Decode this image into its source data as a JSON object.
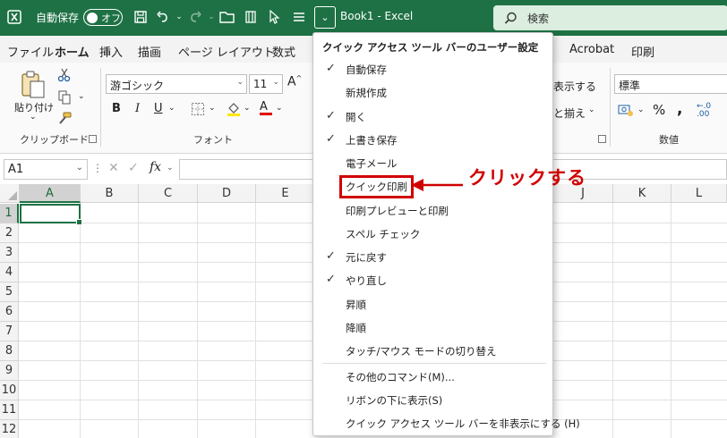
{
  "titlebar": {
    "autosave_label": "自動保存",
    "toggle_state": "オフ",
    "doc_title": "Book1  -  Excel",
    "search_placeholder": "検索"
  },
  "tabs": [
    "ファイル",
    "ホーム",
    "挿入",
    "描画",
    "ページ レイアウト",
    "数式",
    "Acrobat",
    "印刷"
  ],
  "ribbon": {
    "paste_label": "貼り付け",
    "clipboard_group": "クリップボード",
    "font_name": "游ゴシック",
    "font_size": "11",
    "font_group": "フォント",
    "wrap_text": "表示する",
    "merge": "と揃え",
    "number_format": "標準",
    "number_group": "数値",
    "percent": "%"
  },
  "formula_bar": {
    "name_box": "A1",
    "fx": "fx"
  },
  "grid": {
    "columns": [
      "A",
      "B",
      "C",
      "D",
      "E",
      "J",
      "K",
      "L"
    ],
    "rows": [
      "1",
      "2",
      "3",
      "4",
      "5",
      "6",
      "7",
      "8",
      "9",
      "10",
      "11",
      "12"
    ]
  },
  "menu": {
    "title": "クイック アクセス ツール バーのユーザー設定",
    "items": [
      {
        "label": "自動保存",
        "checked": true
      },
      {
        "label": "新規作成",
        "checked": false
      },
      {
        "label": "開く",
        "checked": true
      },
      {
        "label": "上書き保存",
        "checked": true
      },
      {
        "label": "電子メール",
        "checked": false
      },
      {
        "label": "クイック印刷",
        "checked": false
      },
      {
        "label": "印刷プレビューと印刷",
        "checked": false
      },
      {
        "label": "スペル チェック",
        "checked": false
      },
      {
        "label": "元に戻す",
        "checked": true
      },
      {
        "label": "やり直し",
        "checked": true
      },
      {
        "label": "昇順",
        "checked": false
      },
      {
        "label": "降順",
        "checked": false
      },
      {
        "label": "タッチ/マウス モードの切り替え",
        "checked": false
      }
    ],
    "more_commands": "その他のコマンド(M)...",
    "show_below": "リボンの下に表示(S)",
    "hide_qat": "クイック アクセス ツール バーを非表示にする (H)"
  },
  "annotation": {
    "text": "クリックする",
    "color": "#d00000"
  },
  "colors": {
    "excel_green": "#1e7145",
    "search_bg": "#dbeedf"
  }
}
